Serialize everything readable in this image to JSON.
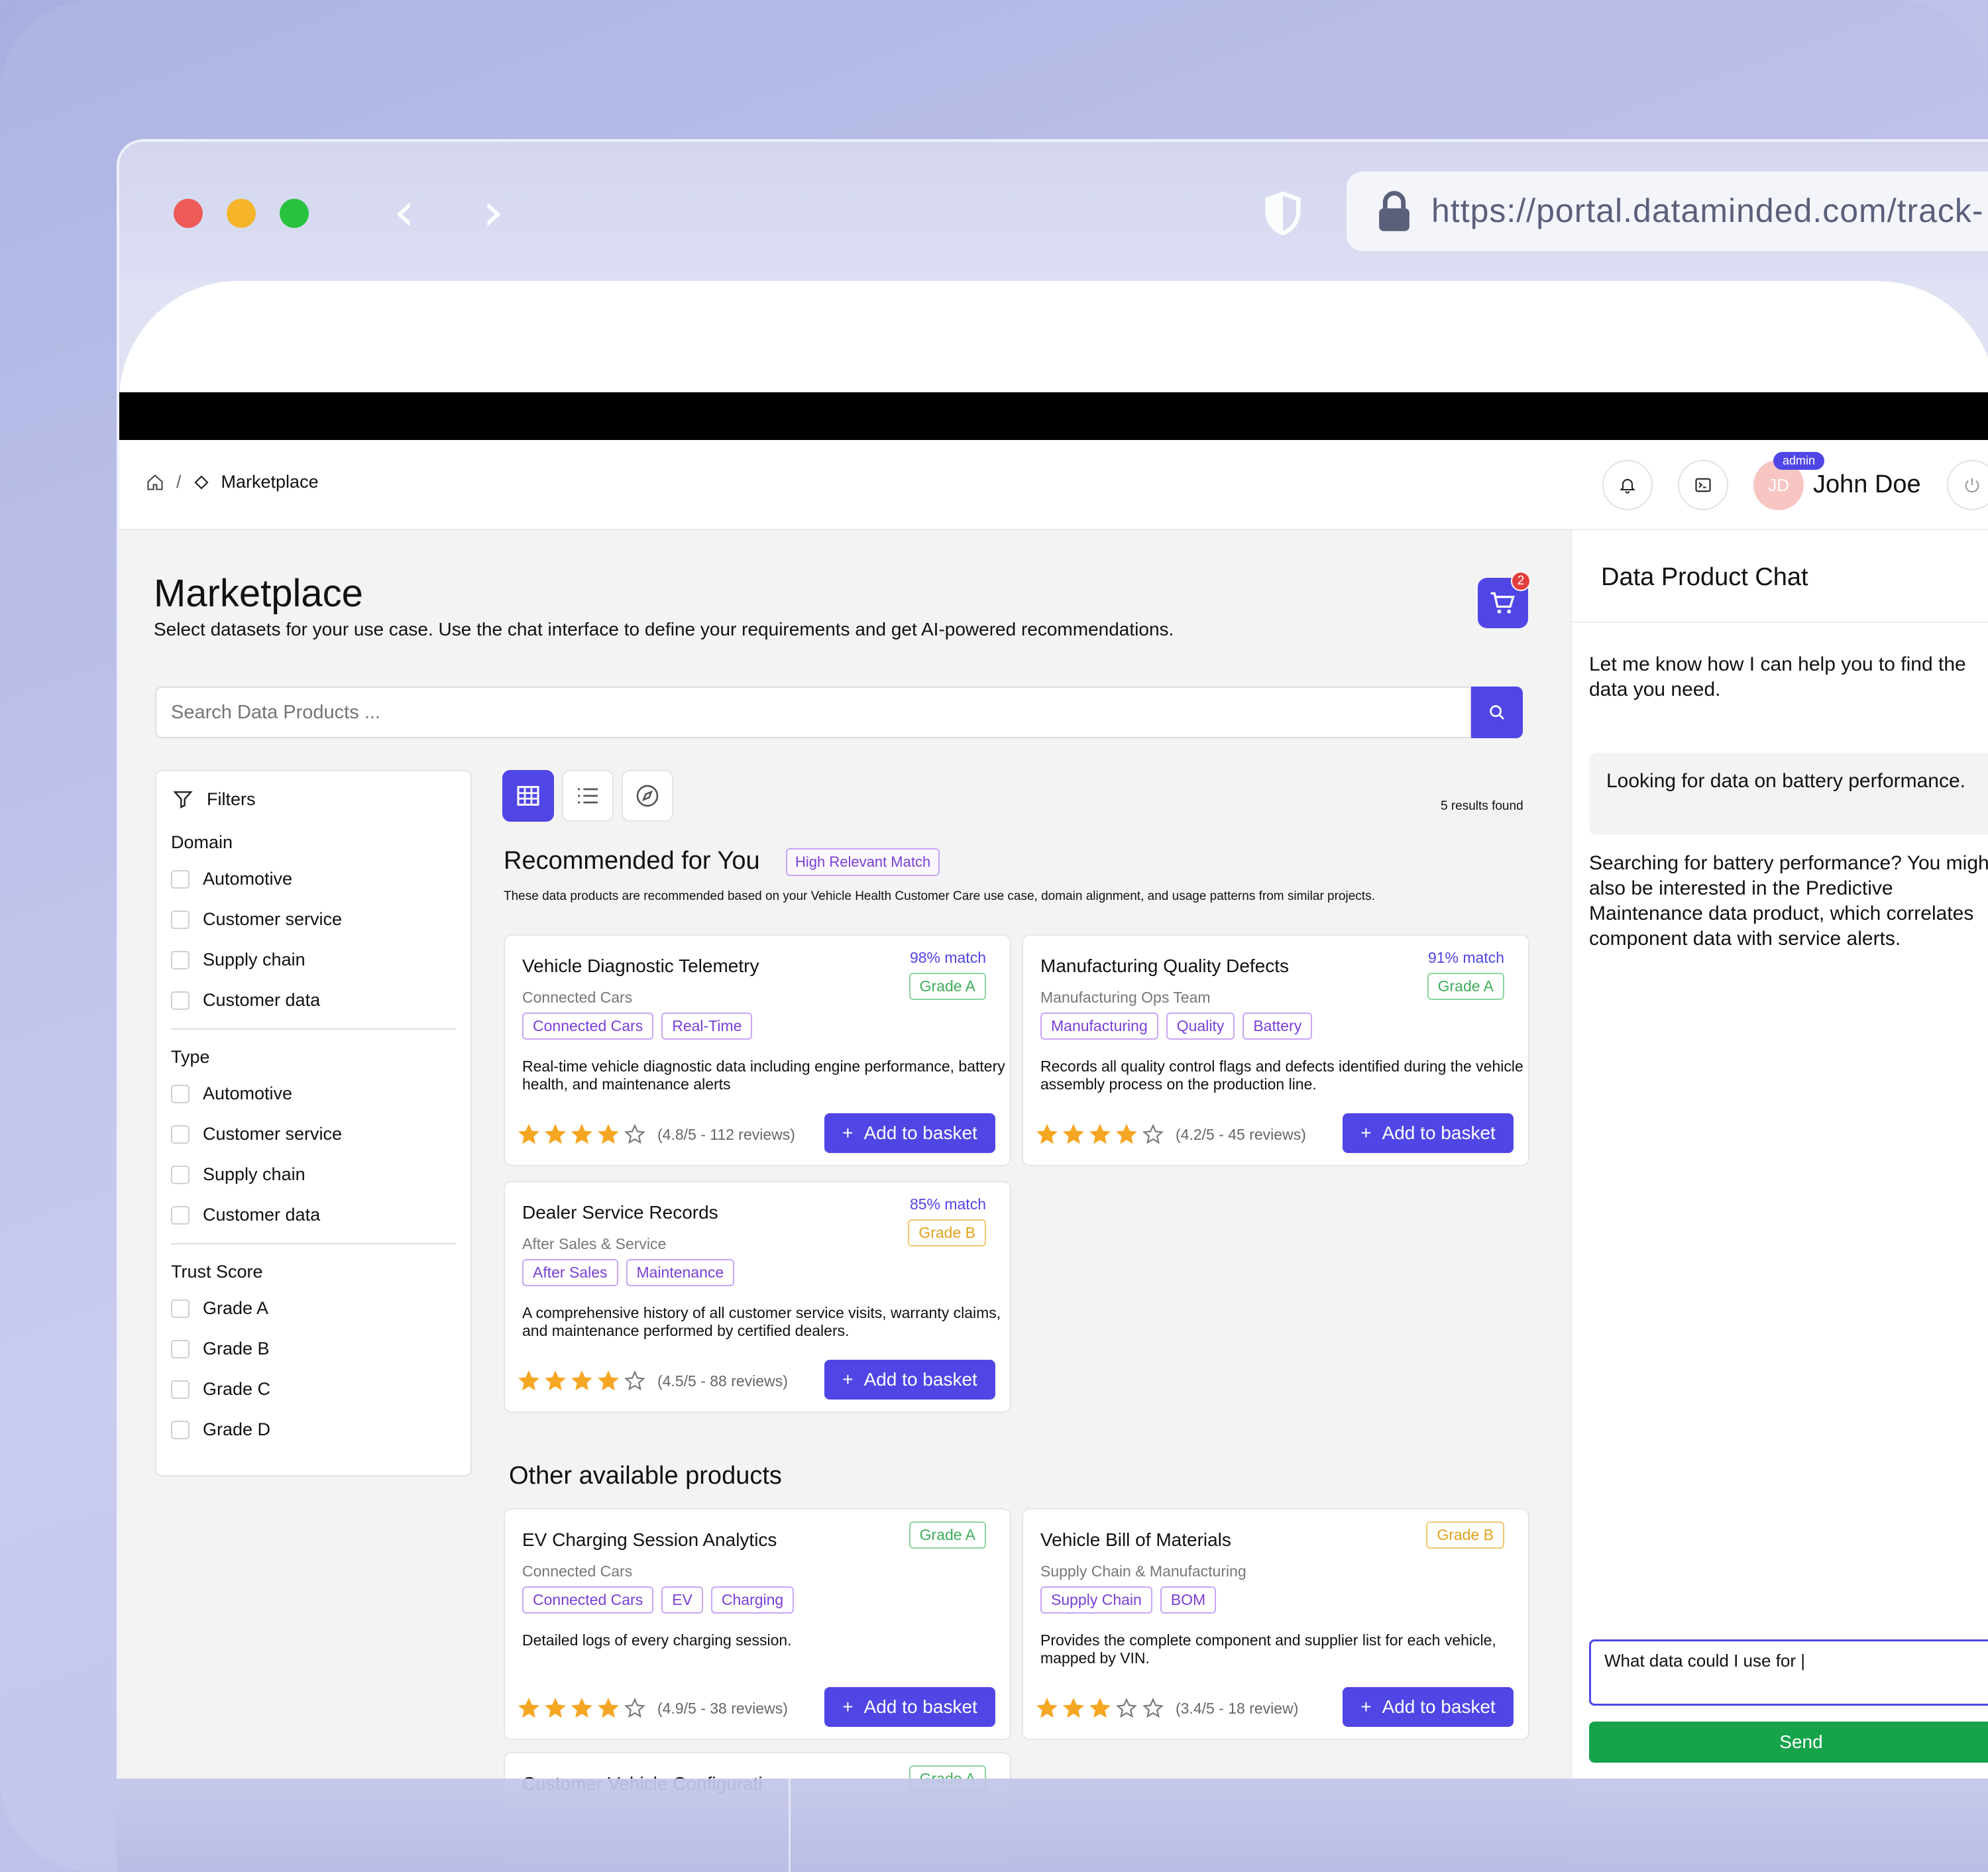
{
  "browser": {
    "url": "https://portal.dataminded.com/track-"
  },
  "topbar": {
    "breadcrumb_current": "Marketplace",
    "user_role": "admin",
    "user_initials": "JD",
    "user_name": "John Doe"
  },
  "page": {
    "title": "Marketplace",
    "subtitle": "Select datasets for your use case. Use the chat interface to define your requirements and get AI-powered recommendations.",
    "cart_count": "2",
    "search_placeholder": "Search Data Products ...",
    "results_text": "5 results found"
  },
  "filters": {
    "title": "Filters",
    "groups": [
      {
        "label": "Domain",
        "options": [
          "Automotive",
          "Customer service",
          "Supply chain",
          "Customer data"
        ]
      },
      {
        "label": "Type",
        "options": [
          "Automotive",
          "Customer service",
          "Supply chain",
          "Customer data"
        ]
      },
      {
        "label": "Trust Score",
        "options": [
          "Grade A",
          "Grade B",
          "Grade C",
          "Grade D"
        ]
      }
    ]
  },
  "recommended": {
    "heading": "Recommended for You",
    "badge": "High Relevant Match",
    "note": "These data products are recommended based on your Vehicle Health Customer Care use case, domain alignment, and usage patterns from similar projects.",
    "cards": [
      {
        "title": "Vehicle Diagnostic Telemetry",
        "owner": "Connected Cars",
        "match": "98% match",
        "grade": "Grade A",
        "tags": [
          "Connected Cars",
          "Real-Time"
        ],
        "desc": "Real-time vehicle diagnostic data including engine performance, battery health, and maintenance alerts",
        "rating": 4.8,
        "reviews": "(4.8/5 - 112 reviews)",
        "button": "Add to basket"
      },
      {
        "title": "Manufacturing Quality Defects",
        "owner": "Manufacturing Ops Team",
        "match": "91% match",
        "grade": "Grade A",
        "tags": [
          "Manufacturing",
          "Quality",
          "Battery"
        ],
        "desc": "Records all quality control flags and defects identified during the vehicle assembly process on the production line.",
        "rating": 4.2,
        "reviews": "(4.2/5 - 45 reviews)",
        "button": "Add to basket"
      },
      {
        "title": "Dealer Service Records",
        "owner": "After Sales & Service",
        "match": "85% match",
        "grade": "Grade B",
        "tags": [
          "After Sales",
          "Maintenance"
        ],
        "desc": "A comprehensive history of all customer service visits, warranty claims, and maintenance performed by certified dealers.",
        "rating": 4.5,
        "reviews": "(4.5/5 - 88 reviews)",
        "button": "Add to basket"
      }
    ]
  },
  "other": {
    "heading": "Other available products",
    "cards": [
      {
        "title": "EV Charging Session Analytics",
        "owner": "Connected Cars",
        "grade": "Grade A",
        "tags": [
          "Connected Cars",
          "EV",
          "Charging"
        ],
        "desc": "Detailed logs of every charging session.",
        "rating": 4.9,
        "reviews": "(4.9/5 - 38 reviews)",
        "button": "Add to basket"
      },
      {
        "title": "Vehicle Bill of Materials",
        "owner": "Supply Chain & Manufacturing",
        "grade": "Grade B",
        "tags": [
          "Supply Chain",
          "BOM"
        ],
        "desc": "Provides the complete component and supplier list for each vehicle, mapped by VIN.",
        "rating": 3.4,
        "reviews": "(3.4/5 - 18 review)",
        "button": "Add to basket"
      },
      {
        "title": "Customer Vehicle Configurati",
        "grade": "Grade A"
      }
    ]
  },
  "chat": {
    "title": "Data Product Chat",
    "bot_intro": "Let me know how I can help you to find the data you need.",
    "user_msg": "Looking for data on battery performance.",
    "bot_reply": "Searching for battery performance? You might also be interested in the Predictive Maintenance data product, which correlates component data with service alerts.",
    "input_value": "What data could I use for |",
    "send_label": "Send"
  },
  "colors": {
    "accent": "#4f46e5",
    "send": "#16a34a",
    "star": "#f5a623",
    "grade_a": "#3eae5b",
    "grade_b": "#e3a21a"
  }
}
